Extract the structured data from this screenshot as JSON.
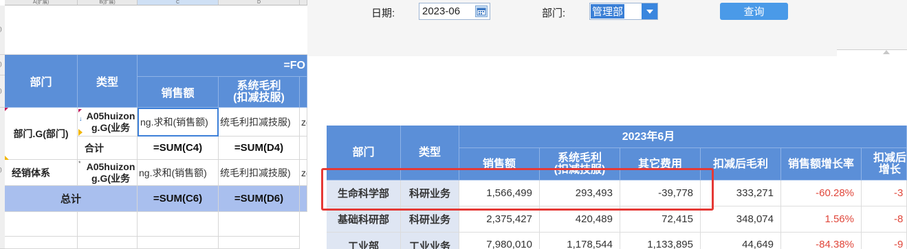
{
  "designer": {
    "col_headers": [
      "A(扩展)",
      "B(扩展)",
      "C",
      "D"
    ],
    "row_headers": [
      ")",
      ")",
      ")",
      ")"
    ],
    "header": {
      "dept": "部门",
      "type": "类型",
      "formula_head": "=FO",
      "sales": "销售额",
      "gross_profit": "系统毛利\n(扣减技服)"
    },
    "rows": [
      {
        "dept": "部门.G(部门)",
        "type": "A05huizong.G(业务",
        "sales": "ng.求和(销售额)",
        "profit": "统毛利扣减技服)",
        "extra": "zc"
      },
      {
        "type": "合计",
        "sales": "=SUM(C4)",
        "profit": "=SUM(D4)"
      },
      {
        "dept": "经销体系",
        "type": "A05huizong.G(业务",
        "sales": "ng.求和(销售额)",
        "profit": "统毛利扣减技服)",
        "extra": "zc"
      },
      {
        "dept": "总计",
        "sales": "=SUM(C6)",
        "profit": "=SUM(D6)"
      }
    ]
  },
  "report": {
    "toolbar": {
      "date_label": "日期:",
      "date_value": "2023-06",
      "dept_label": "部门:",
      "dept_value": "管理部",
      "query_button": "查询"
    },
    "table": {
      "headers": {
        "dept": "部门",
        "type": "类型",
        "period": "2023年6月",
        "sales": "销售额",
        "gross_profit": "系统毛利\n(扣减技服)",
        "other_cost": "其它费用",
        "net_profit": "扣减后毛利",
        "sales_growth": "销售额增长率",
        "net_growth": "扣减后\n增长"
      },
      "rows": [
        {
          "dept": "生命科学部",
          "type": "科研业务",
          "sales": "1,566,499",
          "gross": "293,493",
          "other": "-39,778",
          "net": "333,271",
          "growth": "-60.28%",
          "net_growth": "-3"
        },
        {
          "dept": "基础科研部",
          "type": "科研业务",
          "sales": "2,375,427",
          "gross": "420,489",
          "other": "72,415",
          "net": "348,074",
          "growth": "1.56%",
          "net_growth": "-8"
        },
        {
          "dept": "工业部",
          "type": "工业业务",
          "sales": "7,980,010",
          "gross": "1,178,544",
          "other": "1,133,895",
          "net": "44,649",
          "growth": "-84.38%",
          "net_growth": "-9"
        }
      ]
    },
    "highlight_color": "#e53935",
    "header_color": "#5b8fd8"
  }
}
